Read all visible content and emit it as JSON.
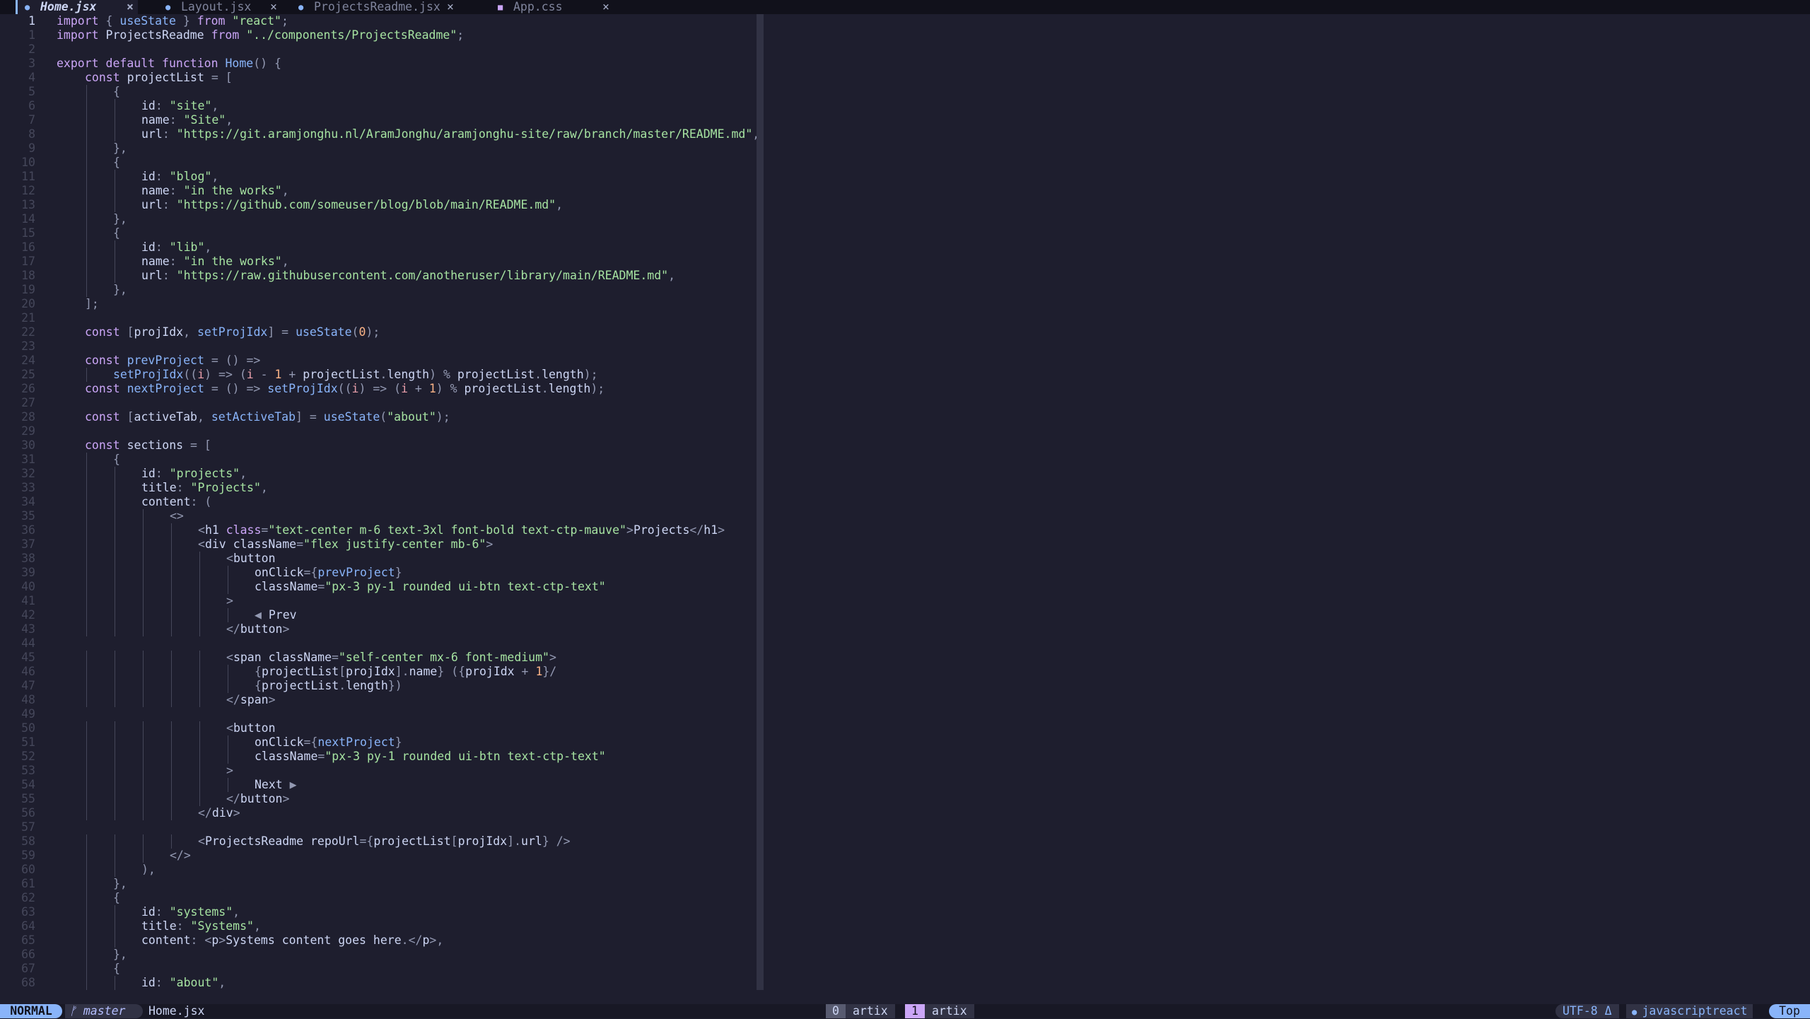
{
  "tabs": [
    {
      "label": "Home.jsx",
      "active": true,
      "icon": "react-icon",
      "close": "×"
    },
    {
      "label": "Layout.jsx",
      "active": false,
      "icon": "react-icon",
      "close": "×"
    },
    {
      "label": "ProjectsReadme.jsx",
      "active": false,
      "icon": "react-icon",
      "close": "×"
    },
    {
      "label": "App.css",
      "active": false,
      "icon": "css-icon",
      "close": "×"
    }
  ],
  "colors": {
    "bg": "#1e1e2e",
    "text": "#cdd6f4",
    "keyword": "#cba6f7",
    "string": "#a6e3a1",
    "func": "#89b4fa",
    "number": "#fab387",
    "punct": "#9399b2",
    "tag": "#cdd6f4",
    "param": "#eba0ac",
    "lineNr": "#45475a",
    "accent": "#89b4fa"
  },
  "editor": {
    "current_line": 1,
    "lines": [
      {
        "n": "1",
        "indent": 0,
        "text": "import { useState } from \"react\";"
      },
      {
        "n": "1",
        "indent": 0,
        "text": "import ProjectsReadme from \"../components/ProjectsReadme\";"
      },
      {
        "n": "2",
        "indent": 0,
        "text": ""
      },
      {
        "n": "3",
        "indent": 0,
        "text": "export default function Home() {"
      },
      {
        "n": "4",
        "indent": 1,
        "text": "const projectList = ["
      },
      {
        "n": "5",
        "indent": 2,
        "text": "{"
      },
      {
        "n": "6",
        "indent": 3,
        "text": "id: \"site\","
      },
      {
        "n": "7",
        "indent": 3,
        "text": "name: \"Site\","
      },
      {
        "n": "8",
        "indent": 3,
        "text": "url: \"https://git.aramjonghu.nl/AramJonghu/aramjonghu-site/raw/branch/master/README.md\","
      },
      {
        "n": "9",
        "indent": 2,
        "text": "},"
      },
      {
        "n": "10",
        "indent": 2,
        "text": "{"
      },
      {
        "n": "11",
        "indent": 3,
        "text": "id: \"blog\","
      },
      {
        "n": "12",
        "indent": 3,
        "text": "name: \"in the works\","
      },
      {
        "n": "13",
        "indent": 3,
        "text": "url: \"https://github.com/someuser/blog/blob/main/README.md\","
      },
      {
        "n": "14",
        "indent": 2,
        "text": "},"
      },
      {
        "n": "15",
        "indent": 2,
        "text": "{"
      },
      {
        "n": "16",
        "indent": 3,
        "text": "id: \"lib\","
      },
      {
        "n": "17",
        "indent": 3,
        "text": "name: \"in the works\","
      },
      {
        "n": "18",
        "indent": 3,
        "text": "url: \"https://raw.githubusercontent.com/anotheruser/library/main/README.md\","
      },
      {
        "n": "19",
        "indent": 2,
        "text": "},"
      },
      {
        "n": "20",
        "indent": 1,
        "text": "];"
      },
      {
        "n": "21",
        "indent": 0,
        "text": ""
      },
      {
        "n": "22",
        "indent": 1,
        "text": "const [projIdx, setProjIdx] = useState(0);"
      },
      {
        "n": "23",
        "indent": 0,
        "text": ""
      },
      {
        "n": "24",
        "indent": 1,
        "text": "const prevProject = () =>"
      },
      {
        "n": "25",
        "indent": 2,
        "text": "setProjIdx((i) => (i - 1 + projectList.length) % projectList.length);"
      },
      {
        "n": "26",
        "indent": 1,
        "text": "const nextProject = () => setProjIdx((i) => (i + 1) % projectList.length);"
      },
      {
        "n": "27",
        "indent": 0,
        "text": ""
      },
      {
        "n": "28",
        "indent": 1,
        "text": "const [activeTab, setActiveTab] = useState(\"about\");"
      },
      {
        "n": "29",
        "indent": 0,
        "text": ""
      },
      {
        "n": "30",
        "indent": 1,
        "text": "const sections = ["
      },
      {
        "n": "31",
        "indent": 2,
        "text": "{"
      },
      {
        "n": "32",
        "indent": 3,
        "text": "id: \"projects\","
      },
      {
        "n": "33",
        "indent": 3,
        "text": "title: \"Projects\","
      },
      {
        "n": "34",
        "indent": 3,
        "text": "content: ("
      },
      {
        "n": "35",
        "indent": 4,
        "text": "<>"
      },
      {
        "n": "36",
        "indent": 5,
        "text": "<h1 class=\"text-center m-6 text-3xl font-bold text-ctp-mauve\">Projects</h1>"
      },
      {
        "n": "37",
        "indent": 5,
        "text": "<div className=\"flex justify-center mb-6\">"
      },
      {
        "n": "38",
        "indent": 6,
        "text": "<button"
      },
      {
        "n": "39",
        "indent": 7,
        "text": "onClick={prevProject}"
      },
      {
        "n": "40",
        "indent": 7,
        "text": "className=\"px-3 py-1 rounded ui-btn text-ctp-text\""
      },
      {
        "n": "41",
        "indent": 6,
        "text": ">"
      },
      {
        "n": "42",
        "indent": 7,
        "text": "◀ Prev"
      },
      {
        "n": "43",
        "indent": 6,
        "text": "</button>"
      },
      {
        "n": "44",
        "indent": 0,
        "text": ""
      },
      {
        "n": "45",
        "indent": 6,
        "text": "<span className=\"self-center mx-6 font-medium\">"
      },
      {
        "n": "46",
        "indent": 7,
        "text": "{projectList[projIdx].name} ({projIdx + 1}/"
      },
      {
        "n": "47",
        "indent": 7,
        "text": "{projectList.length})"
      },
      {
        "n": "48",
        "indent": 6,
        "text": "</span>"
      },
      {
        "n": "49",
        "indent": 0,
        "text": ""
      },
      {
        "n": "50",
        "indent": 6,
        "text": "<button"
      },
      {
        "n": "51",
        "indent": 7,
        "text": "onClick={nextProject}"
      },
      {
        "n": "52",
        "indent": 7,
        "text": "className=\"px-3 py-1 rounded ui-btn text-ctp-text\""
      },
      {
        "n": "53",
        "indent": 6,
        "text": ">"
      },
      {
        "n": "54",
        "indent": 7,
        "text": "Next ▶"
      },
      {
        "n": "55",
        "indent": 6,
        "text": "</button>"
      },
      {
        "n": "56",
        "indent": 5,
        "text": "</div>"
      },
      {
        "n": "57",
        "indent": 0,
        "text": ""
      },
      {
        "n": "58",
        "indent": 5,
        "text": "<ProjectsReadme repoUrl={projectList[projIdx].url} />"
      },
      {
        "n": "59",
        "indent": 4,
        "text": "</>"
      },
      {
        "n": "60",
        "indent": 3,
        "text": "),"
      },
      {
        "n": "61",
        "indent": 2,
        "text": "},"
      },
      {
        "n": "62",
        "indent": 2,
        "text": "{"
      },
      {
        "n": "63",
        "indent": 3,
        "text": "id: \"systems\","
      },
      {
        "n": "64",
        "indent": 3,
        "text": "title: \"Systems\","
      },
      {
        "n": "65",
        "indent": 3,
        "text": "content: <p>Systems content goes here.</p>,"
      },
      {
        "n": "66",
        "indent": 2,
        "text": "},"
      },
      {
        "n": "67",
        "indent": 2,
        "text": "{"
      },
      {
        "n": "68",
        "indent": 3,
        "text": "id: \"about\","
      }
    ]
  },
  "statusbar": {
    "mode": "NORMAL",
    "branch_icon": "git-branch-icon",
    "branch": "master",
    "filename": "Home.jsx",
    "workspaces": [
      {
        "num": "0",
        "label": "artix",
        "color": "#585b70"
      },
      {
        "num": "1",
        "label": "artix",
        "color": "#cba6f7"
      }
    ],
    "encoding": "UTF-8",
    "os_icon": "linux-icon",
    "filetype": "javascriptreact",
    "position": "Top"
  }
}
